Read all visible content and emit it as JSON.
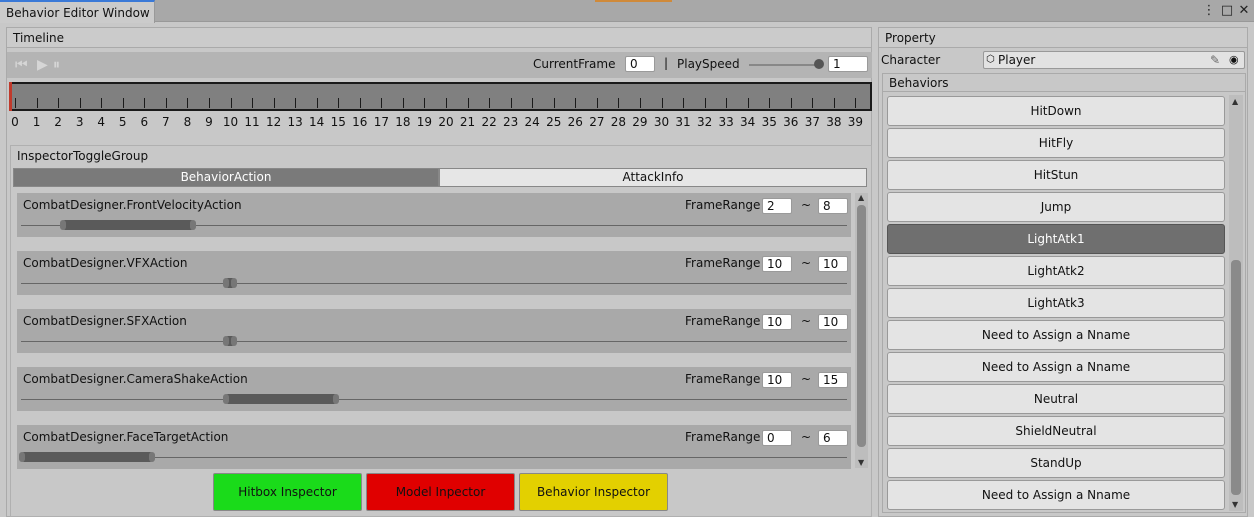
{
  "window": {
    "title": "Behavior Editor Window",
    "menu_icon": "⋮",
    "maximize_icon": "□",
    "close_icon": "✕"
  },
  "timeline": {
    "header": "Timeline",
    "toolbar": {
      "first_frame_icon": "⏮",
      "play_icon": "▶",
      "pause_icon": "⏸",
      "current_frame_label": "CurrentFrame",
      "current_frame_value": "0",
      "separator": "|",
      "play_speed_label": "PlaySpeed",
      "play_speed_value": "1",
      "play_speed_slider_fraction": 1.0
    },
    "ruler": {
      "frames": [
        "0",
        "1",
        "2",
        "3",
        "4",
        "5",
        "6",
        "7",
        "8",
        "9",
        "10",
        "11",
        "12",
        "13",
        "14",
        "15",
        "16",
        "17",
        "18",
        "19",
        "20",
        "21",
        "22",
        "23",
        "24",
        "25",
        "26",
        "27",
        "28",
        "29",
        "30",
        "31",
        "32",
        "33",
        "34",
        "35",
        "36",
        "37",
        "38",
        "39"
      ]
    }
  },
  "inspector": {
    "group_label": "InspectorToggleGroup",
    "tabs": [
      {
        "label": "BehaviorAction",
        "active": true
      },
      {
        "label": "AttackInfo",
        "active": false
      }
    ],
    "frame_range_label": "FrameRange",
    "tilde": "~",
    "actions": [
      {
        "name": "CombatDesigner.FrontVelocityAction",
        "start": "2",
        "end": "8"
      },
      {
        "name": "CombatDesigner.VFXAction",
        "start": "10",
        "end": "10"
      },
      {
        "name": "CombatDesigner.SFXAction",
        "start": "10",
        "end": "10"
      },
      {
        "name": "CombatDesigner.CameraShakeAction",
        "start": "10",
        "end": "15"
      },
      {
        "name": "CombatDesigner.FaceTargetAction",
        "start": "0",
        "end": "6"
      }
    ],
    "buttons": [
      {
        "label": "Hitbox Inspector",
        "color": "#1adb1a"
      },
      {
        "label": "Model Inpector",
        "color": "#e00000"
      },
      {
        "label": "Behavior Inspector",
        "color": "#e3d000"
      }
    ],
    "scroll_up_icon": "▲",
    "scroll_down_icon": "▼"
  },
  "property": {
    "header": "Property",
    "character_label": "Character",
    "character_value": "Player",
    "character_icon": "⬡",
    "edit_icon": "✎",
    "target_icon": "◉",
    "behaviors_label": "Behaviors",
    "behaviors": [
      {
        "label": "HitDown",
        "selected": false
      },
      {
        "label": "HitFly",
        "selected": false
      },
      {
        "label": "HitStun",
        "selected": false
      },
      {
        "label": "Jump",
        "selected": false
      },
      {
        "label": "LightAtk1",
        "selected": true
      },
      {
        "label": "LightAtk2",
        "selected": false
      },
      {
        "label": "LightAtk3",
        "selected": false
      },
      {
        "label": "Need to Assign a Nname",
        "selected": false
      },
      {
        "label": "Need to Assign a Nname",
        "selected": false
      },
      {
        "label": "Neutral",
        "selected": false
      },
      {
        "label": "ShieldNeutral",
        "selected": false
      },
      {
        "label": "StandUp",
        "selected": false
      },
      {
        "label": "Need to Assign a Nname",
        "selected": false
      }
    ],
    "scroll_up_icon": "▲",
    "scroll_down_icon": "▼"
  },
  "colors": {
    "accent": "#3a79d7",
    "selected_behavior": "#6f6f6f",
    "ruler_start_marker": "#c0392b"
  }
}
